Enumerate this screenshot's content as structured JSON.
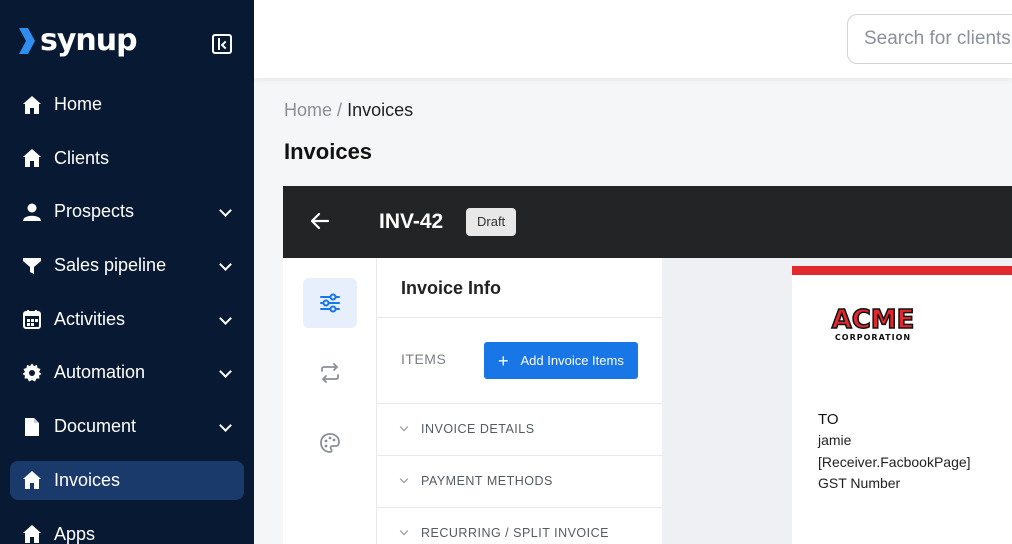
{
  "brand": {
    "name": "synup"
  },
  "sidebar": {
    "items": [
      {
        "label": "Home",
        "icon": "home-icon",
        "chevron": false,
        "active": false
      },
      {
        "label": "Clients",
        "icon": "home-icon",
        "chevron": false,
        "active": false
      },
      {
        "label": "Prospects",
        "icon": "user-icon",
        "chevron": true,
        "active": false
      },
      {
        "label": "Sales pipeline",
        "icon": "funnel-icon",
        "chevron": true,
        "active": false
      },
      {
        "label": "Activities",
        "icon": "calendar-icon",
        "chevron": true,
        "active": false
      },
      {
        "label": "Automation",
        "icon": "gear-icon",
        "chevron": true,
        "active": false
      },
      {
        "label": "Document",
        "icon": "document-icon",
        "chevron": true,
        "active": false
      },
      {
        "label": "Invoices",
        "icon": "home-icon",
        "chevron": false,
        "active": true
      },
      {
        "label": "Apps",
        "icon": "home-icon",
        "chevron": false,
        "active": false
      }
    ]
  },
  "search": {
    "placeholder": "Search for clients"
  },
  "breadcrumb": {
    "root": "Home",
    "separator": "/",
    "current": "Invoices"
  },
  "page": {
    "title": "Invoices"
  },
  "invoice": {
    "id": "INV-42",
    "status": "Draft",
    "panel_title": "Invoice Info",
    "items_label": "ITEMS",
    "add_button": "Add Invoice Items",
    "sections": [
      "INVOICE DETAILS",
      "PAYMENT METHODS",
      "RECURRING / SPLIT INVOICE"
    ]
  },
  "preview": {
    "logo_main": "ACME",
    "logo_sub": "CORPORATION",
    "to_label": "TO",
    "receiver_lines": [
      "jamie",
      "[Receiver.FacbookPage]",
      "GST Number"
    ],
    "accent_color": "#e0282e"
  },
  "colors": {
    "sidebar_bg": "#081a33",
    "active_item": "#1a3a6b",
    "primary": "#1976e6"
  }
}
